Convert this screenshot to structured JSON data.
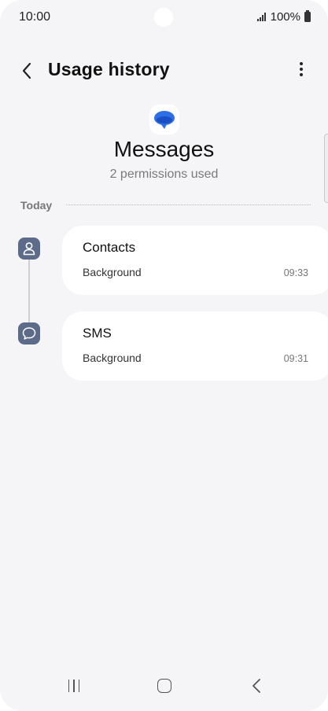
{
  "status_bar": {
    "time": "10:00",
    "battery": "100%",
    "icons": [
      "signal-icon",
      "battery-icon"
    ]
  },
  "header": {
    "title": "Usage history",
    "back_icon": "back-arrow-icon",
    "more_icon": "more-options-icon"
  },
  "app": {
    "name": "Messages",
    "subtitle": "2 permissions used",
    "icon": "messages-app-icon",
    "icon_color": "#2f6fe6"
  },
  "section": {
    "label": "Today"
  },
  "entries": [
    {
      "title": "Contacts",
      "subtitle": "Background",
      "time": "09:33",
      "icon": "person-icon"
    },
    {
      "title": "SMS",
      "subtitle": "Background",
      "time": "09:31",
      "icon": "chat-bubble-icon"
    }
  ],
  "nav": {
    "icons": [
      "recents-icon",
      "home-icon",
      "nav-back-icon"
    ]
  },
  "colors": {
    "background": "#f5f5f7",
    "card": "#ffffff",
    "timeline_icon_bg": "#5c6b8a",
    "secondary_text": "#7a7a7a"
  }
}
